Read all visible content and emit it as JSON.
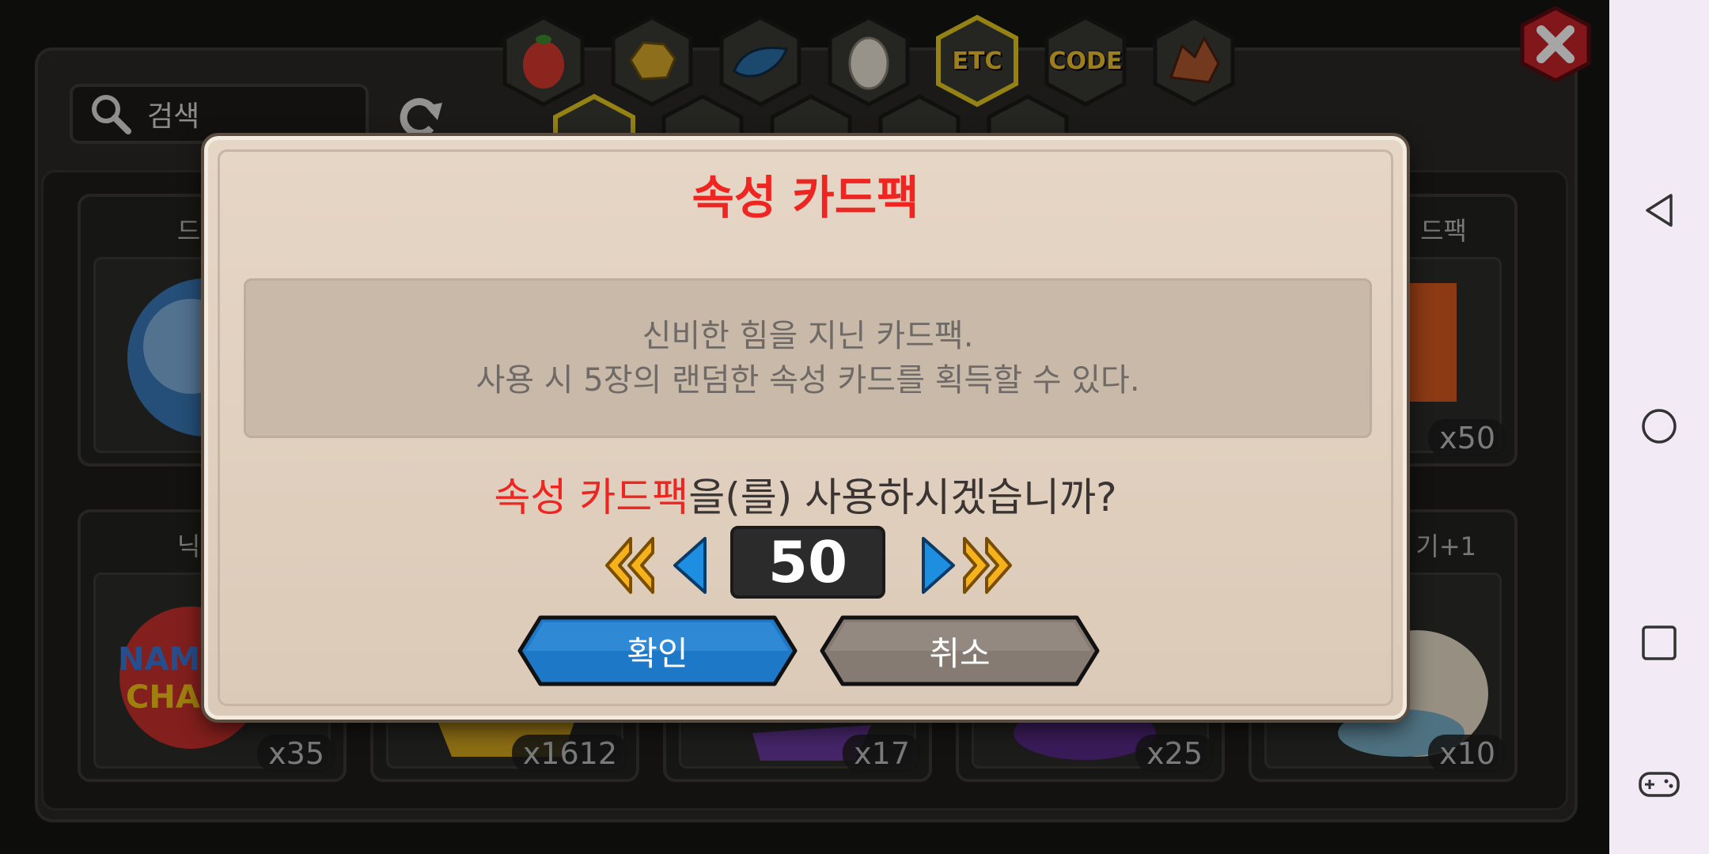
{
  "search": {
    "placeholder": "검색"
  },
  "categories": {
    "row1": [
      {
        "icon": "fruit-icon"
      },
      {
        "icon": "gold-ore-icon"
      },
      {
        "icon": "dragon-scale-icon"
      },
      {
        "icon": "egg-icon"
      },
      {
        "label": "ETC",
        "active": true
      },
      {
        "label": "CODE"
      },
      {
        "icon": "dragon-head-icon"
      }
    ]
  },
  "inventory": {
    "slots": [
      {
        "name": "드래곤",
        "count": ""
      },
      {
        "name": "드팩",
        "count": "x50"
      },
      {
        "name": "닉네임",
        "count": "x35"
      },
      {
        "name": "",
        "count": "x1612"
      },
      {
        "name": "",
        "count": "x17"
      },
      {
        "name": "",
        "count": "x25"
      },
      {
        "name": "기+1",
        "count": "x10"
      }
    ]
  },
  "dialog": {
    "title": "속성 카드팩",
    "description_line1": "신비한 힘을 지닌 카드팩.",
    "description_line2": "사용 시 5장의 랜덤한 속성 카드를 획득할 수 있다.",
    "question_item": "속성 카드팩",
    "question_rest": "을(를) 사용하시겠습니까?",
    "quantity": "50",
    "confirm_label": "확인",
    "cancel_label": "취소"
  },
  "colors": {
    "accent_red": "#ee2520",
    "confirm_blue": "#1e78c8",
    "cancel_gray": "#8a8178",
    "arrow_blue": "#1e8fe0",
    "arrow_gold": "#f5b21a"
  }
}
